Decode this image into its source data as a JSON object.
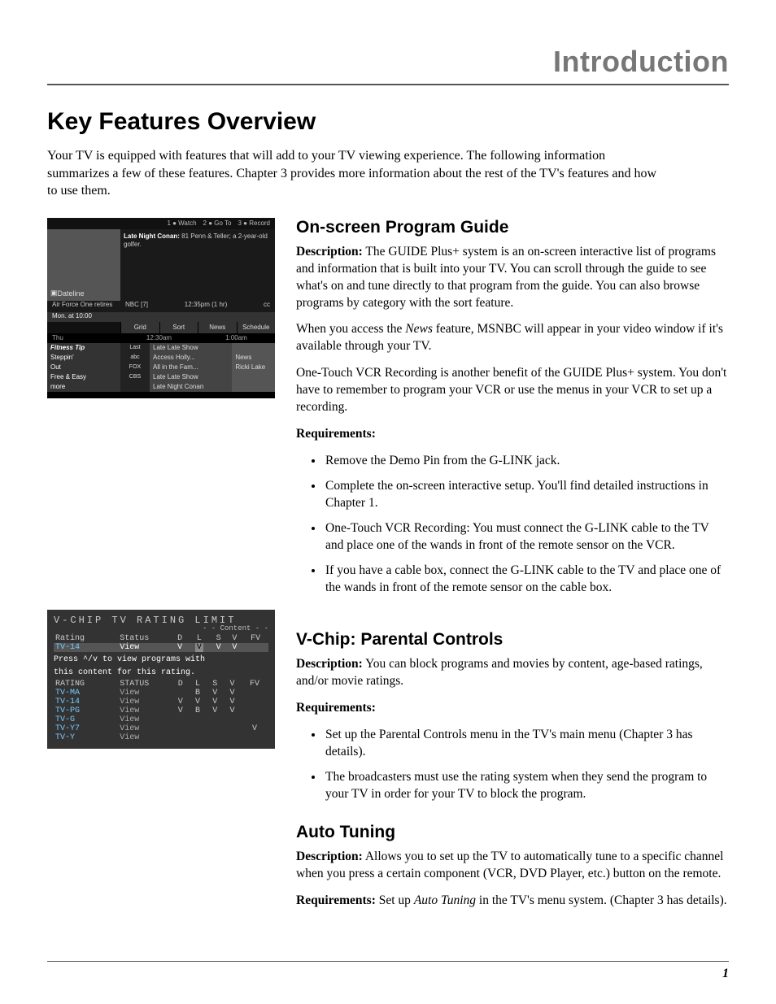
{
  "header": {
    "section": "Introduction"
  },
  "h1": "Key Features Overview",
  "intro": "Your TV is equipped with features that will add to your TV viewing experience. The following information summarizes a few of these features. Chapter 3 provides more information about the rest of the TV's features and how to use them.",
  "sec1": {
    "title": "On-screen Program Guide",
    "desc_label": "Description:",
    "desc": "The GUIDE Plus+ system is an on-screen interactive list of programs and information that is built into your TV. You can scroll through the guide to see what's on and tune directly to that program from the guide. You can also browse programs by category with the sort feature.",
    "p2a": "When you access the ",
    "p2_news": "News",
    "p2b": " feature, MSNBC will appear in your video window if it's available through your TV.",
    "p3": "One-Touch VCR Recording is another benefit of the GUIDE Plus+ system. You don't have to remember to program your VCR or use the menus in your VCR to set up a recording.",
    "req_label": "Requirements:",
    "reqs": [
      "Remove the Demo Pin from the G-LINK jack.",
      "Complete the on-screen interactive setup. You'll find detailed instructions in Chapter 1.",
      "One-Touch VCR Recording: You must connect the G-LINK cable to the TV and place one of the wands in front of the remote sensor on the VCR.",
      "If you have a cable box, connect the G-LINK cable to the TV and place one of the wands in front of the remote sensor on the cable box."
    ]
  },
  "sec2": {
    "title": "V-Chip: Parental Controls",
    "desc_label": "Description:",
    "desc": "You can block programs and movies by content, age-based ratings, and/or movie ratings.",
    "req_label": "Requirements:",
    "req1a": "Set up the ",
    "req1_i": "Parental Controls",
    "req1b": " menu in the TV's main menu (Chapter 3 has details).",
    "req2": "The broadcasters must use the rating system when they send the program to your TV in order for your TV to block the program."
  },
  "sec3": {
    "title": "Auto Tuning",
    "desc_label": "Description:",
    "desc": "Allows you to set up the TV to automatically tune to a specific channel when you press a certain component (VCR, DVD Player, etc.) button on the remote.",
    "req_label": "Requirements:",
    "req_a": "Set up ",
    "req_i": "Auto Tuning",
    "req_b": " in the TV's menu system. (Chapter 3 has details)."
  },
  "fig1": {
    "top": [
      "1 ● Watch",
      "2 ● Go To",
      "3 ● Record"
    ],
    "video_label": "Dateline",
    "prog_title": "Late Night Conan:",
    "prog_rest": " 81 Penn & Teller; a 2-year-old golfer.",
    "info_eps": "Air Force One retires",
    "info_date": "Mon. at 10:00",
    "channel": "NBC [7]",
    "time_label": "12:35pm (1 hr)",
    "cc": "cc",
    "tabs": [
      "Grid",
      "Sort",
      "News",
      "Schedule"
    ],
    "timerow": {
      "l": "Thu",
      "c1": "12:30am",
      "c2": "1:00am"
    },
    "fitness_title": "Fitness Tip",
    "fitness_lines": [
      "Steppin'",
      "Out",
      "Free & Easy"
    ],
    "more": "more",
    "rows": [
      {
        "ch": "Last Channel",
        "p1": "Late Late Show",
        "p2": ""
      },
      {
        "ch": "abc",
        "p1": "Access Holly...",
        "p2": "News"
      },
      {
        "ch": "FOX",
        "p1": "All in the Fam...",
        "p2": "Ricki Lake"
      },
      {
        "ch": "CBS",
        "p1": "Late Late Show",
        "p2": ""
      },
      {
        "ch": "",
        "p1": "Late Night Conan",
        "p2": ""
      }
    ]
  },
  "fig2": {
    "title": "V-CHIP TV RATING LIMIT",
    "content_label": "- - Content - -",
    "hdr": [
      "Rating",
      "Status",
      "D",
      "L",
      "S",
      "V",
      "FV"
    ],
    "highlight": {
      "rating": "TV-14",
      "status": "View",
      "cols": [
        "V",
        "V",
        "V",
        "V",
        ""
      ]
    },
    "msg1": "Press ^/v to view programs with",
    "msg2": "this content for this rating.",
    "hdr2": [
      "RATING",
      "STATUS",
      "D",
      "L",
      "S",
      "V",
      "FV"
    ],
    "rows": [
      {
        "r": "TV-MA",
        "s": "View",
        "c": [
          "",
          "B",
          "V",
          "V",
          ""
        ]
      },
      {
        "r": "TV-14",
        "s": "View",
        "c": [
          "V",
          "V",
          "V",
          "V",
          ""
        ]
      },
      {
        "r": "TV-PG",
        "s": "View",
        "c": [
          "V",
          "B",
          "V",
          "V",
          ""
        ]
      },
      {
        "r": "TV-G",
        "s": "View",
        "c": [
          "",
          "",
          "",
          "",
          ""
        ]
      },
      {
        "r": "TV-Y7",
        "s": "View",
        "c": [
          "",
          "",
          "",
          "",
          "V"
        ]
      },
      {
        "r": "TV-Y",
        "s": "View",
        "c": [
          "",
          "",
          "",
          "",
          ""
        ]
      }
    ]
  },
  "page": "1"
}
